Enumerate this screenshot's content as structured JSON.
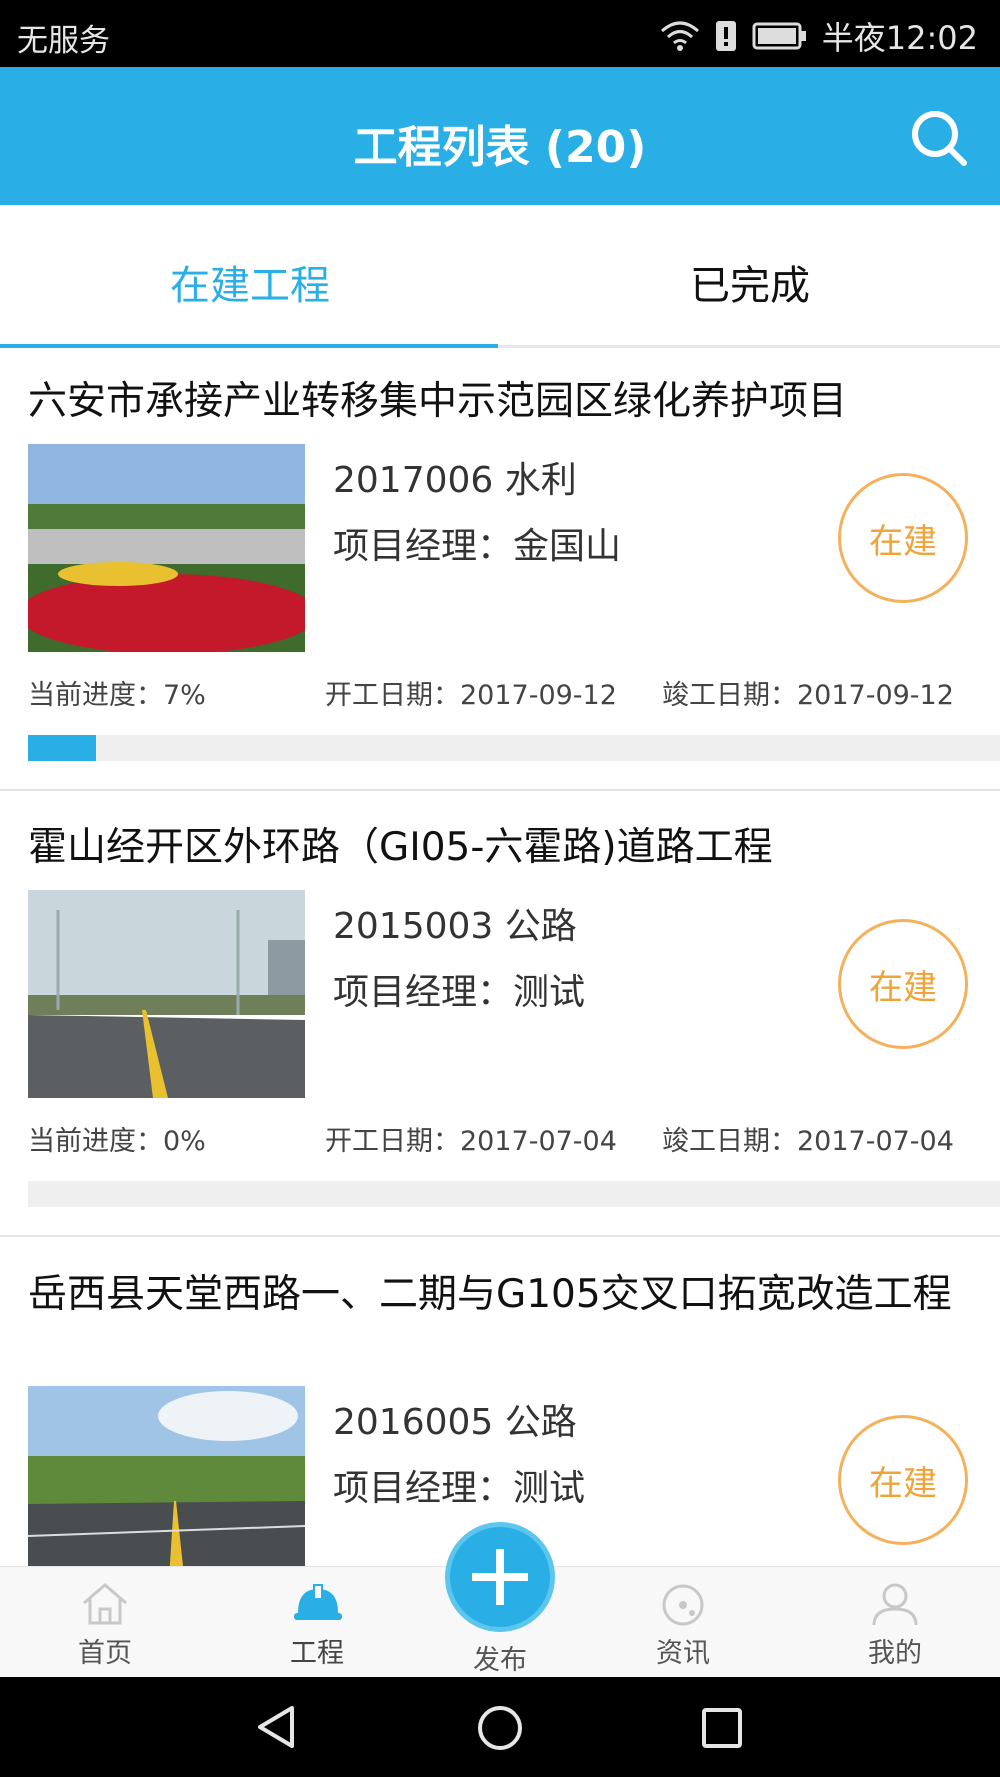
{
  "status_bar": {
    "carrier": "无服务",
    "time": "半夜12:02",
    "icons": [
      "wifi-icon",
      "alert-icon",
      "battery-icon"
    ]
  },
  "header": {
    "title": "工程列表 (20)",
    "search_icon": "search-icon"
  },
  "tabs": [
    {
      "label": "在建工程",
      "active": true
    },
    {
      "label": "已完成",
      "active": false
    }
  ],
  "projects": [
    {
      "title": "六安市承接产业转移集中示范园区绿化养护项目",
      "code_type": "2017006 水利",
      "manager": "项目经理：金国山",
      "status": "在建",
      "progress_label": "当前进度：7%",
      "progress": 0.07,
      "start": "开工日期：2017-09-12",
      "end": "竣工日期：2017-09-12"
    },
    {
      "title": "霍山经开区外环路（GI05-六霍路)道路工程",
      "code_type": "2015003 公路",
      "manager": "项目经理：测试",
      "status": "在建",
      "progress_label": "当前进度：0%",
      "progress": 0,
      "start": "开工日期：2017-07-04",
      "end": "竣工日期：2017-07-04"
    },
    {
      "title": "岳西县天堂西路一、二期与G105交叉口拓宽改造工程",
      "code_type": "2016005 公路",
      "manager": "项目经理：测试",
      "status": "在建"
    }
  ],
  "bottom_nav": [
    {
      "label": "首页",
      "icon": "home-icon"
    },
    {
      "label": "工程",
      "icon": "helmet-icon"
    },
    {
      "label": "发布",
      "icon": "plus-icon"
    },
    {
      "label": "资讯",
      "icon": "news-icon"
    },
    {
      "label": "我的",
      "icon": "person-icon"
    }
  ],
  "colors": {
    "primary": "#29aee6",
    "badge": "#f0a33b"
  }
}
